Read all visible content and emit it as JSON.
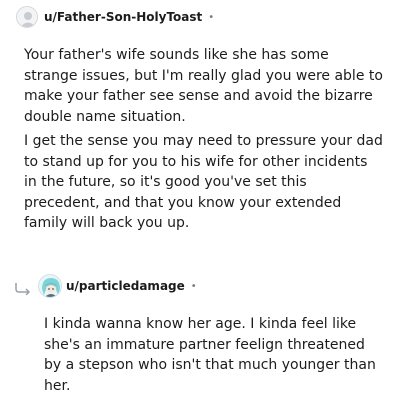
{
  "comments": [
    {
      "author": "u/Father-Son-HolyToast",
      "separator": "•",
      "avatar_icon": "default-user-avatar-icon",
      "paragraphs": [
        "Your father's wife sounds like she has some strange issues, but I'm really glad you were able to make your father see sense and avoid the bizarre double name situation.",
        "I get the sense you may need to pressure your dad to stand up for you to his wife for other incidents in the future, so it's good you've set this precedent, and that you know your extended family will back you up."
      ]
    },
    {
      "author": "u/particledamage",
      "separator": "•",
      "avatar_icon": "anime-character-avatar-icon",
      "reply_icon": "reply-thread-arrow-icon",
      "paragraphs": [
        "I kinda wanna know her age. I kinda feel like she's an immature partner feelign threatened by a stepson who isn't that much younger than her."
      ]
    }
  ]
}
